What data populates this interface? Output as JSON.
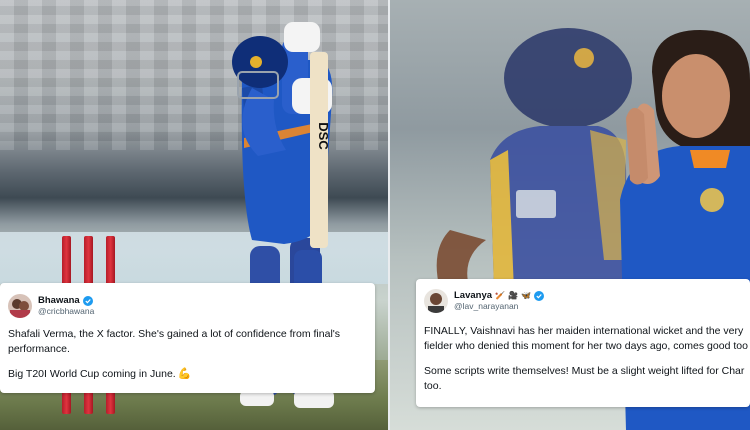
{
  "tweets": [
    {
      "display_name": "Bhawana",
      "handle": "@cricbhawana",
      "verified": true,
      "paragraphs": [
        "Shafali Verma, the X factor. She's gained a lot of confidence from final's performance.",
        "Big T20I World Cup coming in June."
      ],
      "trailing_icon": "flexed-biceps-icon"
    },
    {
      "display_name": "Lavanya",
      "handle": "@lav_narayanan",
      "verified": true,
      "name_emojis": [
        "🏏",
        "🎥",
        "🦋"
      ],
      "paragraphs": [
        "FINALLY, Vaishnavi has her maiden international wicket and the very",
        "fielder who denied this moment for her two days ago, comes good too",
        "Some scripts write themselves! Must be a slight weight lifted for Char",
        "too."
      ]
    }
  ],
  "photo_left": {
    "bat_brand": "DSC"
  },
  "colors": {
    "india_blue": "#1f58c4",
    "sl_blue": "#3a4fa0",
    "sl_yellow": "#e4b73a",
    "verified": "#1d9bf0",
    "stump_red": "#d32b36"
  }
}
